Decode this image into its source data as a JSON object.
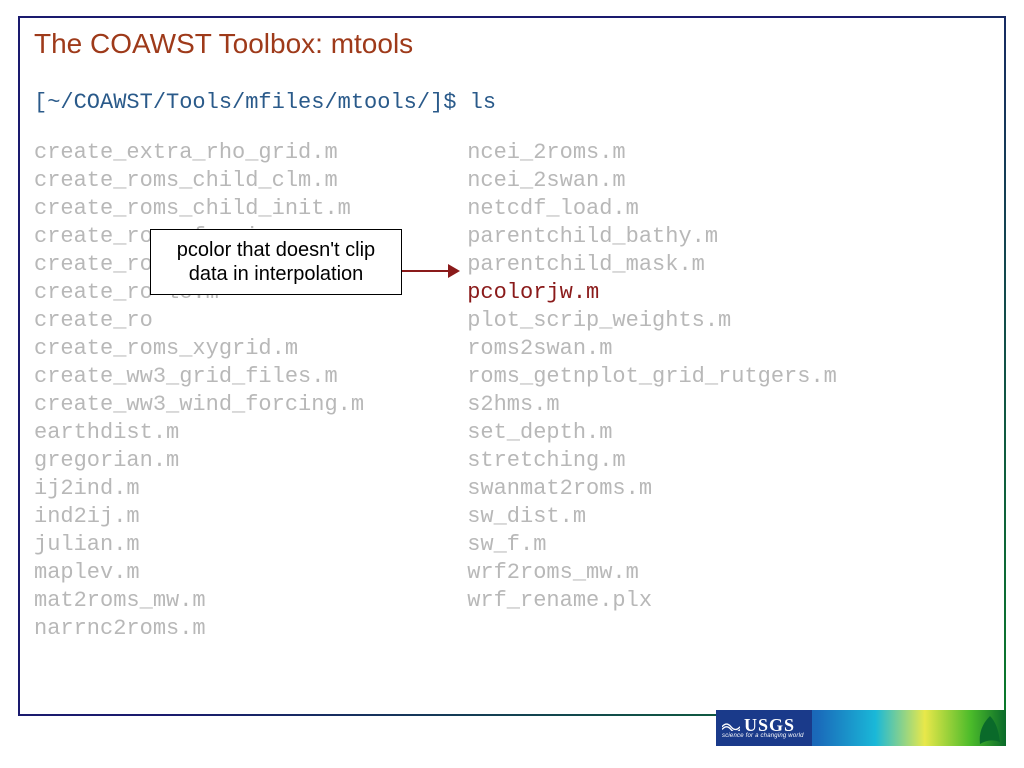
{
  "title": "The COAWST Toolbox: mtools",
  "prompt": "[~/COAWST/Tools/mfiles/mtools/]$ ls",
  "col1": [
    "create_extra_rho_grid.m",
    "create_roms_child_clm.m",
    "create_roms_child_init.m",
    "create_roms_forcings.m",
    "create_ro",
    "create_ro                le.m",
    "create_ro",
    "create_roms_xygrid.m",
    "create_ww3_grid_files.m",
    "create_ww3_wind_forcing.m",
    "earthdist.m",
    "gregorian.m",
    "ij2ind.m",
    "ind2ij.m",
    "julian.m",
    "maplev.m",
    "mat2roms_mw.m",
    "narrnc2roms.m"
  ],
  "col2": [
    "ncei_2roms.m",
    "ncei_2swan.m",
    "netcdf_load.m",
    "parentchild_bathy.m",
    "parentchild_mask.m",
    "pcolorjw.m",
    "plot_scrip_weights.m",
    "roms2swan.m",
    "roms_getnplot_grid_rutgers.m",
    "s2hms.m",
    "set_depth.m",
    "stretching.m",
    "swanmat2roms.m",
    "sw_dist.m",
    "sw_f.m",
    "wrf2roms_mw.m",
    "wrf_rename.plx"
  ],
  "highlight_index": 5,
  "callout": "pcolor that doesn't clip data in interpolation",
  "usgs": {
    "name": "USGS",
    "tag": "science for a changing world"
  }
}
